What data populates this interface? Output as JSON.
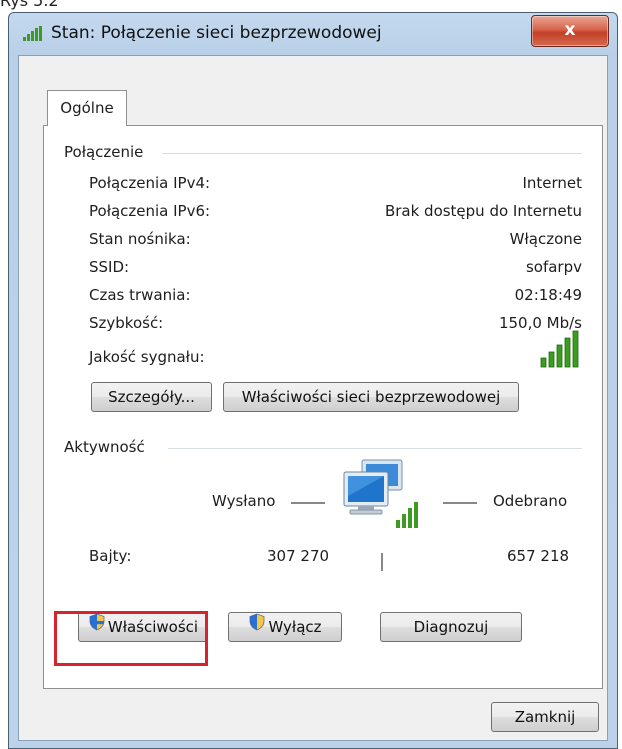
{
  "caption": "Rys 5.2",
  "window": {
    "title": "Stan: Połączenie sieci bezprzewodowej",
    "close_label": "x"
  },
  "tabs": [
    {
      "label": "Ogólne"
    }
  ],
  "connection": {
    "header": "Połączenie",
    "rows": [
      {
        "label": "Połączenia IPv4:",
        "value": "Internet"
      },
      {
        "label": "Połączenia IPv6:",
        "value": "Brak dostępu do Internetu"
      },
      {
        "label": "Stan nośnika:",
        "value": "Włączone"
      },
      {
        "label": "SSID:",
        "value": "sofarpv"
      },
      {
        "label": "Czas trwania:",
        "value": "02:18:49"
      },
      {
        "label": "Szybkość:",
        "value": "150,0 Mb/s"
      }
    ],
    "signal_label": "Jakość sygnału:",
    "signal_bars": 5,
    "details_button": "Szczegóły...",
    "wireless_props_button": "Właściwości sieci bezprzewodowej"
  },
  "activity": {
    "header": "Aktywność",
    "sent_label": "Wysłano",
    "received_label": "Odebrano",
    "bytes_label": "Bajty:",
    "bytes_sent": "307 270",
    "bytes_received": "657 218"
  },
  "buttons": {
    "properties": "Właściwości",
    "disable": "Wyłącz",
    "diagnose": "Diagnozuj",
    "close": "Zamknij"
  },
  "colors": {
    "highlight": "#d7232d",
    "signal_green": "#3d9b22",
    "close_red": "#c2402a"
  },
  "icons": {
    "title": "wifi-signal-icon",
    "signal": "signal-strength-icon",
    "network": "network-computers-icon",
    "shield": "uac-shield-icon"
  }
}
